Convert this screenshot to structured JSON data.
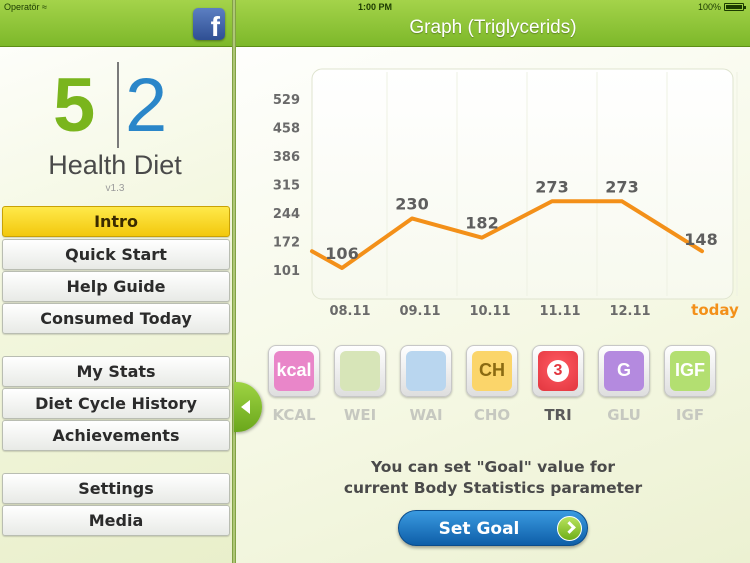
{
  "status_bar": {
    "carrier": "Operatör",
    "time": "1:00 PM",
    "battery": "100%",
    "battery_level": 1.0
  },
  "sidebar": {
    "facebook_icon": "f",
    "logo": {
      "number_left": "5",
      "number_right": "2",
      "title": "Health Diet",
      "version": "v1.3"
    },
    "menu": [
      {
        "label": "Intro",
        "active": true
      },
      {
        "label": "Quick Start"
      },
      {
        "label": "Help Guide"
      },
      {
        "label": "Consumed Today"
      },
      {
        "label": "My Stats"
      },
      {
        "label": "Diet Cycle History"
      },
      {
        "label": "Achievements"
      },
      {
        "label": "Settings"
      },
      {
        "label": "Media"
      }
    ]
  },
  "header": {
    "title": "Graph (Triglycerids)"
  },
  "chart_data": {
    "type": "line",
    "y_ticks": [
      "529",
      "458",
      "386",
      "315",
      "244",
      "172",
      "101"
    ],
    "categories": [
      "08.11",
      "09.11",
      "10.11",
      "11.11",
      "12.11",
      "today"
    ],
    "points": [
      {
        "label": "",
        "value": 148
      },
      {
        "label": "106",
        "value": 106
      },
      {
        "label": "230",
        "value": 230
      },
      {
        "label": "182",
        "value": 182
      },
      {
        "label": "273",
        "value": 273
      },
      {
        "label": "273",
        "value": 273
      },
      {
        "label": "148",
        "value": 148
      }
    ],
    "ylim": [
      101,
      529
    ],
    "line_color": "#f39019",
    "today_color": "#f39019"
  },
  "params": [
    {
      "id": "kcal",
      "label": "KCAL",
      "icon_text": "kcal",
      "icon_name": "kcal-icon",
      "color": "#e986c9"
    },
    {
      "id": "wei",
      "label": "WEI",
      "icon_text": "",
      "icon_name": "scale-icon",
      "color": "#d7e5b8"
    },
    {
      "id": "wai",
      "label": "WAI",
      "icon_text": "",
      "icon_name": "waist-icon",
      "color": "#b9d6ef"
    },
    {
      "id": "cho",
      "label": "CHO",
      "icon_text": "CH",
      "icon_name": "cholesterol-icon",
      "color": "#fbd56a"
    },
    {
      "id": "tri",
      "label": "TRI",
      "icon_text": "3",
      "icon_name": "heart-icon",
      "color": "#e2363f",
      "active": true
    },
    {
      "id": "glu",
      "label": "GLU",
      "icon_text": "G",
      "icon_name": "glucose-icon",
      "color": "#b48adf"
    },
    {
      "id": "igf",
      "label": "IGF",
      "icon_text": "IGF",
      "icon_name": "igf-icon",
      "color": "#b3df71"
    }
  ],
  "goal": {
    "line1": "You can set \"Goal\" value for",
    "line2": "current Body Statistics parameter",
    "button_label": "Set Goal"
  }
}
